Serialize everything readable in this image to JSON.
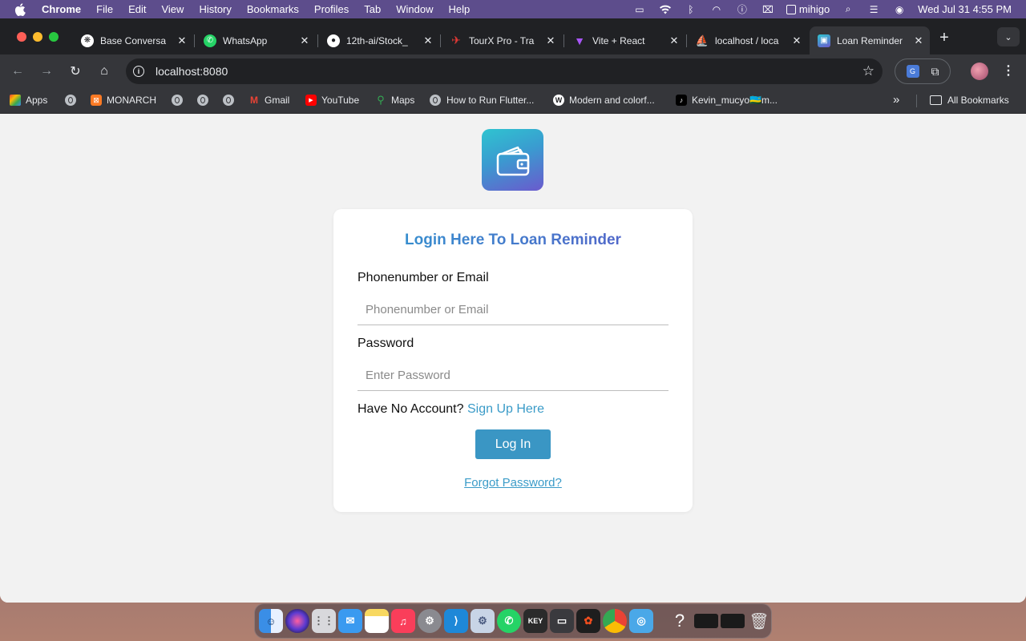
{
  "menubar": {
    "app_name": "Chrome",
    "items": [
      "File",
      "Edit",
      "View",
      "History",
      "Bookmarks",
      "Profiles",
      "Tab",
      "Window",
      "Help"
    ],
    "user": "mihigo",
    "datetime": "Wed Jul 31  4:55 PM"
  },
  "tabs": [
    {
      "label": "Base Conversa",
      "icon": "openai-icon",
      "color": "#ffffff"
    },
    {
      "label": "WhatsApp",
      "icon": "whatsapp-icon",
      "color": "#25d366"
    },
    {
      "label": "12th-ai/Stock_",
      "icon": "github-icon",
      "color": "#ffffff"
    },
    {
      "label": "TourX Pro - Tra",
      "icon": "tourx-icon",
      "color": "#e53935"
    },
    {
      "label": "Vite + React",
      "icon": "vite-icon",
      "color": "#a855f7"
    },
    {
      "label": "localhost / loca",
      "icon": "phpmyadmin-icon",
      "color": "#f08a24"
    },
    {
      "label": "Loan Reminder",
      "icon": "wallet-icon",
      "color": "#3a9bd0",
      "active": true
    }
  ],
  "address_bar": {
    "url": "localhost:8080"
  },
  "bookmarks": [
    {
      "label": "Apps",
      "icon": "apps-grid-icon"
    },
    {
      "label": "",
      "icon": "globe-icon"
    },
    {
      "label": "MONARCH",
      "icon": "xampp-icon"
    },
    {
      "label": "",
      "icon": "globe-icon"
    },
    {
      "label": "",
      "icon": "globe-icon"
    },
    {
      "label": "",
      "icon": "globe-icon"
    },
    {
      "label": "Gmail",
      "icon": "gmail-icon"
    },
    {
      "label": "YouTube",
      "icon": "youtube-icon"
    },
    {
      "label": "Maps",
      "icon": "maps-icon"
    },
    {
      "label": "How to Run Flutter...",
      "icon": "globe-icon"
    },
    {
      "label": "Modern and colorf...",
      "icon": "w-icon"
    },
    {
      "label": "Kevin_mucyo🇷🇼m...",
      "icon": "tiktok-icon"
    }
  ],
  "bookmarks_more": "»",
  "all_bookmarks": "All Bookmarks",
  "login": {
    "title": "Login Here To Loan Reminder",
    "identifier_label": "Phonenumber or Email",
    "identifier_placeholder": "Phonenumber or Email",
    "password_label": "Password",
    "password_placeholder": "Enter Password",
    "no_account_text": "Have No Account?",
    "signup_link": "Sign Up Here",
    "login_button": "Log In",
    "forgot_link": "Forgot Password?"
  },
  "colors": {
    "accent": "#3a96c4",
    "title_gradient_start": "#2e9ad0",
    "title_gradient_end": "#5a5cc8",
    "page_bg": "#f2f2f2"
  },
  "dock": [
    "finder-icon",
    "siri-icon",
    "launchpad-icon",
    "mail-icon",
    "notes-icon",
    "music-icon",
    "settings-icon",
    "vscode-icon",
    "preferences-icon",
    "whatsapp-icon",
    "keynote-icon",
    "window-icon",
    "figma-icon",
    "chrome-icon",
    "app-icon",
    "help-icon",
    "terminal-icon",
    "terminal2-icon",
    "trash-icon"
  ]
}
